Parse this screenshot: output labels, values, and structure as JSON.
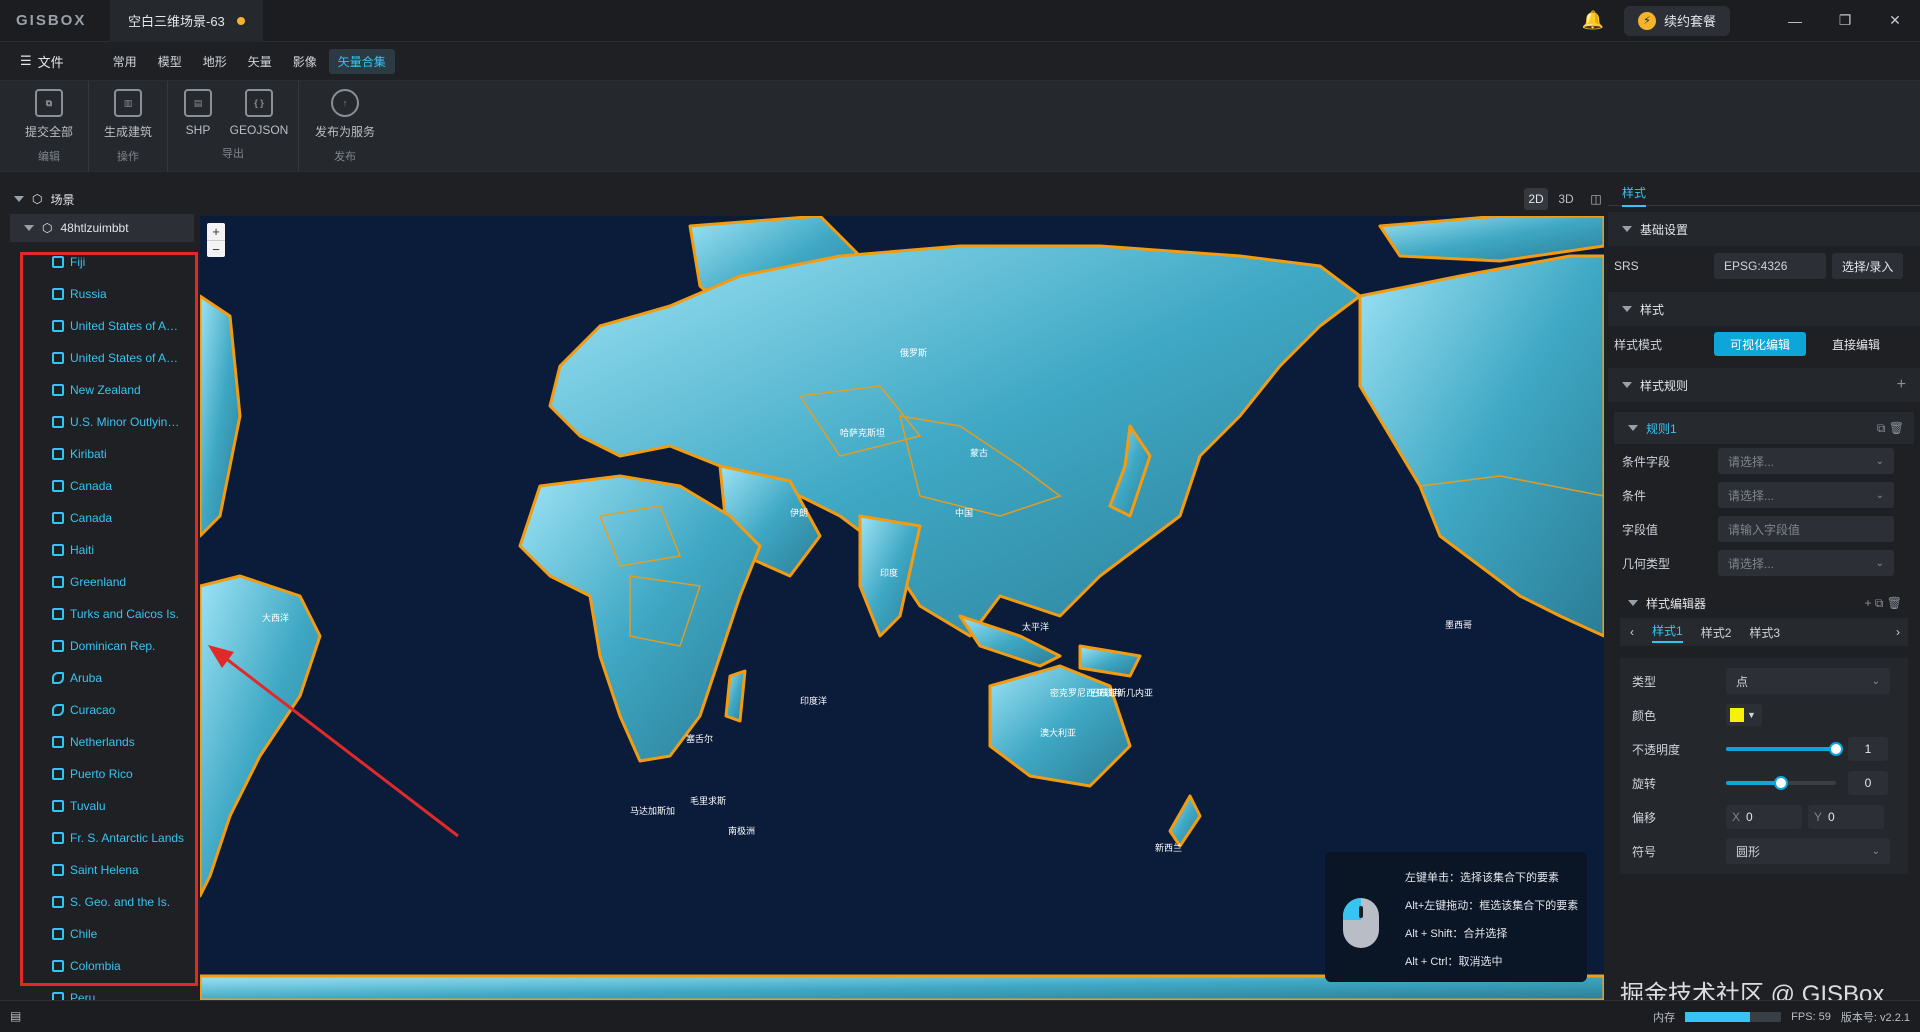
{
  "app": {
    "logo": "GISBOX",
    "document_tab": "空白三维场景-63",
    "renew_label": "续约套餐"
  },
  "menu": {
    "file": "文件",
    "items": [
      "常用",
      "模型",
      "地形",
      "矢量",
      "影像",
      "矢量合集"
    ],
    "active": "矢量合集"
  },
  "ribbon": {
    "groups": [
      {
        "label": "编辑",
        "buttons": [
          {
            "label": "提交全部",
            "icon": "submit-all-icon"
          }
        ]
      },
      {
        "label": "操作",
        "buttons": [
          {
            "label": "生成建筑",
            "icon": "building-icon"
          }
        ]
      },
      {
        "label": "导出",
        "buttons": [
          {
            "label": "SHP",
            "icon": "shp-file-icon"
          },
          {
            "label": "GEOJSON",
            "icon": "geojson-file-icon"
          }
        ]
      },
      {
        "label": "发布",
        "buttons": [
          {
            "label": "发布为服务",
            "icon": "cloud-upload-icon"
          }
        ]
      }
    ]
  },
  "scene": {
    "header": "场景",
    "root": "48htlzuimbbt",
    "items": [
      {
        "label": "Fiji",
        "shape": "multi"
      },
      {
        "label": "Russia",
        "shape": "multi"
      },
      {
        "label": "United States of A…",
        "shape": "multi"
      },
      {
        "label": "United States of A…",
        "shape": "multi"
      },
      {
        "label": "New Zealand",
        "shape": "multi"
      },
      {
        "label": "U.S. Minor Outlyin…",
        "shape": "multi"
      },
      {
        "label": "Kiribati",
        "shape": "multi"
      },
      {
        "label": "Canada",
        "shape": "multi"
      },
      {
        "label": "Canada",
        "shape": "multi"
      },
      {
        "label": "Haiti",
        "shape": "multi"
      },
      {
        "label": "Greenland",
        "shape": "multi"
      },
      {
        "label": "Turks and Caicos Is.",
        "shape": "multi"
      },
      {
        "label": "Dominican Rep.",
        "shape": "multi"
      },
      {
        "label": "Aruba",
        "shape": "poly"
      },
      {
        "label": "Curacao",
        "shape": "poly"
      },
      {
        "label": "Netherlands",
        "shape": "multi"
      },
      {
        "label": "Puerto Rico",
        "shape": "multi"
      },
      {
        "label": "Tuvalu",
        "shape": "multi"
      },
      {
        "label": "Fr. S. Antarctic Lands",
        "shape": "multi"
      },
      {
        "label": "Saint Helena",
        "shape": "multi"
      },
      {
        "label": "S. Geo. and the Is.",
        "shape": "multi"
      },
      {
        "label": "Chile",
        "shape": "multi"
      },
      {
        "label": "Colombia",
        "shape": "multi"
      },
      {
        "label": "Peru",
        "shape": "multi"
      }
    ]
  },
  "view_modes": [
    "2D",
    "3D",
    "◫"
  ],
  "map": {
    "zoom_in": "+",
    "zoom_out": "−",
    "labels": [
      {
        "text": "大西洋"
      },
      {
        "text": "太平洋"
      },
      {
        "text": "印度洋"
      },
      {
        "text": "南极洲"
      },
      {
        "text": "中国"
      },
      {
        "text": "蒙古"
      },
      {
        "text": "俄罗斯"
      },
      {
        "text": "澳大利亚"
      },
      {
        "text": "哈萨克斯坦"
      },
      {
        "text": "印度"
      },
      {
        "text": "伊朗"
      },
      {
        "text": "新西兰"
      },
      {
        "text": "巴布亚新几内亚"
      },
      {
        "text": "马达加斯加"
      },
      {
        "text": "毛里求斯"
      },
      {
        "text": "塞舌尔"
      },
      {
        "text": "密克罗尼西亚联邦"
      },
      {
        "text": "墨西哥"
      }
    ],
    "hints": [
      "左键单击：选择该集合下的要素",
      "Alt+左键拖动：框选该集合下的要素",
      "Alt + Shift：合并选择",
      "Alt + Ctrl：取消选中"
    ]
  },
  "properties": {
    "tab": "样式",
    "basic_section": "基础设置",
    "srs_label": "SRS",
    "srs_value": "EPSG:4326",
    "srs_button": "选择/录入",
    "style_section": "样式",
    "style_mode_label": "样式模式",
    "mode_visual": "可视化编辑",
    "mode_direct": "直接编辑",
    "rules_section": "样式规则",
    "rule_name": "规则1",
    "condition_field_label": "条件字段",
    "condition_field_ph": "请选择...",
    "condition_label": "条件",
    "condition_ph": "请选择...",
    "field_value_label": "字段值",
    "field_value_ph": "请输入字段值",
    "geometry_label": "几何类型",
    "geometry_ph": "请选择...",
    "editor_section": "样式编辑器",
    "style_tabs": [
      "样式1",
      "样式2",
      "样式3"
    ],
    "type_label": "类型",
    "type_value": "点",
    "color_label": "颜色",
    "color_value": "#f5f10b",
    "opacity_label": "不透明度",
    "opacity_value": "1",
    "opacity_fraction": 1.0,
    "rotation_label": "旋转",
    "rotation_value": "0",
    "rotation_fraction": 0.5,
    "offset_label": "偏移",
    "offset_x_label": "X",
    "offset_x": "0",
    "offset_y_label": "Y",
    "offset_y": "0",
    "symbol_label": "符号",
    "symbol_value": "圆形"
  },
  "status": {
    "memory_label": "内存",
    "memory_fraction": 0.68,
    "fps": "FPS: 59",
    "version": "版本号: v2.2.1"
  },
  "watermark": "掘金技术社区 @ GISBox",
  "colors": {
    "accent": "#38c4f0",
    "land_outline": "#f39c12",
    "ocean": "#0b1b3a",
    "highlight": "#e02a2a"
  }
}
